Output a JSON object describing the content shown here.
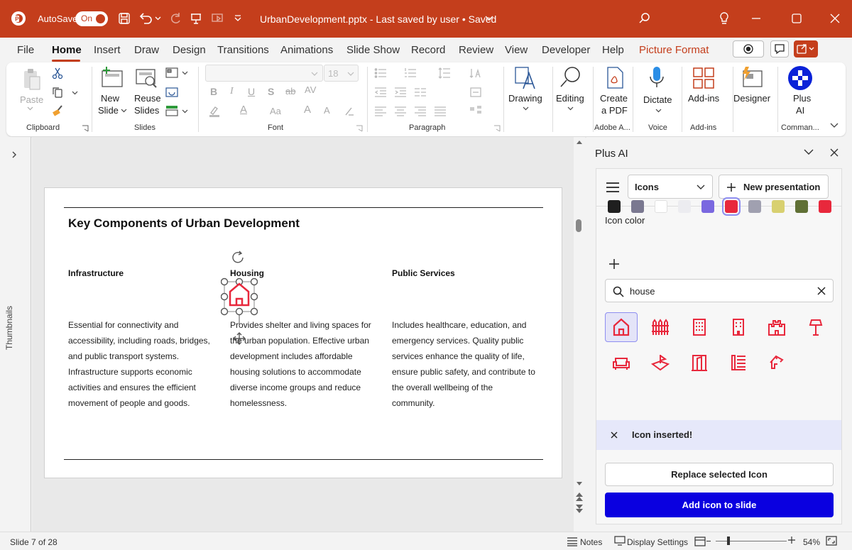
{
  "titlebar": {
    "autosave_label": "AutoSave",
    "autosave_state": "On",
    "doc_title": "UrbanDevelopment.pptx  -  Last saved by user • Saved"
  },
  "tabs": [
    "File",
    "Home",
    "Insert",
    "Draw",
    "Design",
    "Transitions",
    "Animations",
    "Slide Show",
    "Record",
    "Review",
    "View",
    "Developer",
    "Help",
    "Picture Format"
  ],
  "ribbon": {
    "clipboard": {
      "paste": "Paste",
      "label": "Clipboard"
    },
    "slides": {
      "new_slide_1": "New",
      "new_slide_2": "Slide",
      "reuse_1": "Reuse",
      "reuse_2": "Slides",
      "label": "Slides"
    },
    "font": {
      "size": "18",
      "label": "Font"
    },
    "paragraph": {
      "label": "Paragraph"
    },
    "drawing": "Drawing",
    "editing": "Editing",
    "create_pdf_1": "Create",
    "create_pdf_2": "a PDF",
    "adobe_label": "Adobe A...",
    "dictate": "Dictate",
    "voice_label": "Voice",
    "addins": "Add-ins",
    "addins_label": "Add-ins",
    "designer": "Designer",
    "plusai_1": "Plus",
    "plusai_2": "AI",
    "commands_label": "Comman..."
  },
  "thumbnails_label": "Thumbnails",
  "slide": {
    "title": "Key Components of Urban Development",
    "columns": [
      {
        "heading": "Infrastructure",
        "body": "Essential for connectivity and accessibility, including roads, bridges, and public transport systems. Infrastructure supports economic activities and ensures the efficient movement of people and goods."
      },
      {
        "heading": "Housing",
        "body": "Provides shelter and living spaces for the urban population. Effective urban development includes affordable housing solutions to accommodate diverse income groups and reduce homelessness."
      },
      {
        "heading": "Public Services",
        "body": "Includes healthcare, education, and emergency services. Quality public services enhance the quality of life, ensure public safety, and contribute to the overall wellbeing of the community."
      }
    ]
  },
  "panel": {
    "title": "Plus AI",
    "dropdown_value": "Icons",
    "new_presentation": "New presentation",
    "icon_color_label": "Icon color",
    "swatches": [
      "#1f1f1f",
      "#7a7890",
      "#ffffff",
      "#ececf0",
      "#7a68e0",
      "#e8283c",
      "#a0a0b0",
      "#d8d070",
      "#607035",
      "#e8283c"
    ],
    "search_value": "house",
    "icons": [
      "home-outline-icon",
      "fence-icon",
      "apartment-building-icon",
      "office-building-icon",
      "castle-icon",
      "lamp-post-icon",
      "sofa-icon",
      "boat-house-icon",
      "door-icon",
      "list-house-icon",
      "roof-icon"
    ],
    "toast": "Icon inserted!",
    "replace_button": "Replace selected Icon",
    "add_button": "Add icon to slide",
    "accent": "#e8283c",
    "primary": "#0a00e0"
  },
  "status": {
    "slide_counter": "Slide 7 of 28",
    "notes": "Notes",
    "display_settings": "Display Settings",
    "zoom": "54%"
  }
}
